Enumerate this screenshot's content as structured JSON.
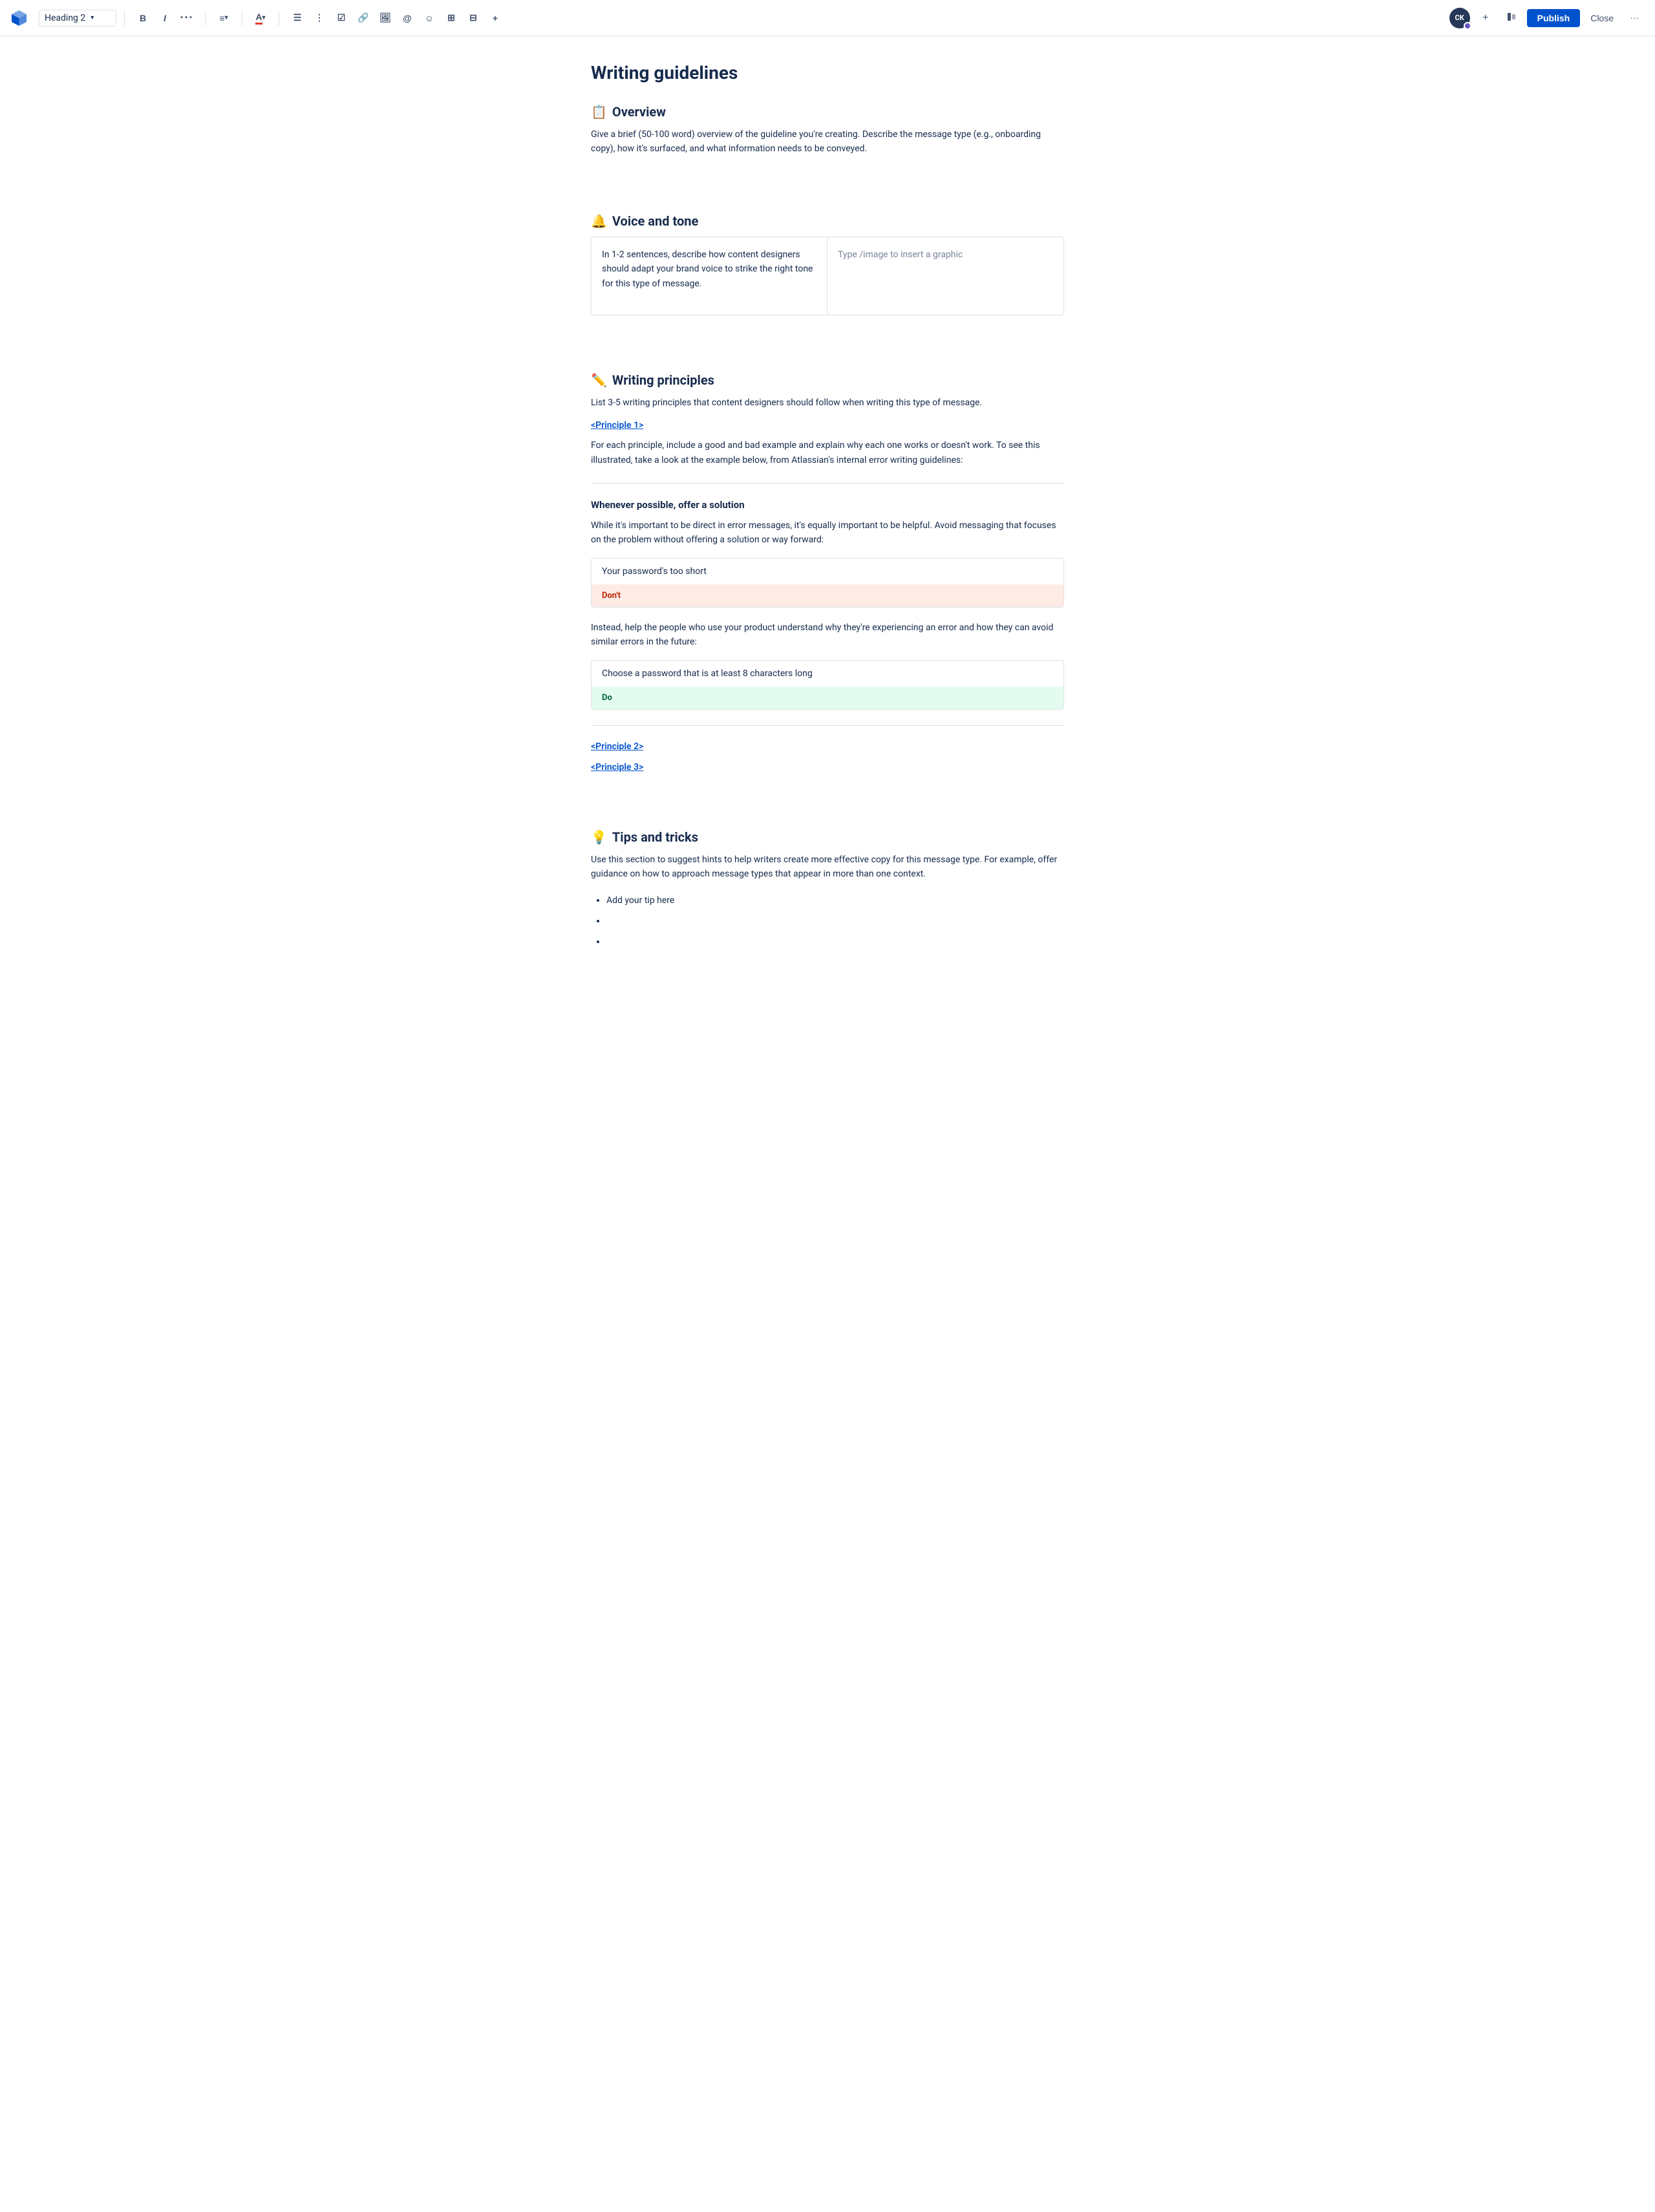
{
  "toolbar": {
    "heading_selector": "Heading 2",
    "chevron": "▾",
    "bold_label": "B",
    "italic_label": "I",
    "more_label": "•••",
    "align_label": "≡",
    "color_label": "A",
    "unordered_list_label": "☰",
    "ordered_list_label": "☰",
    "task_label": "✓",
    "link_label": "🔗",
    "image_label": "🖼",
    "mention_label": "@",
    "emoji_label": "☺",
    "table_label": "⊞",
    "layout_label": "⊟",
    "more2_label": "+",
    "avatar_initials": "CK",
    "add_label": "+",
    "share_label": "👤",
    "publish_label": "Publish",
    "close_label": "Close",
    "overflow_label": "•••"
  },
  "page": {
    "title": "Writing guidelines"
  },
  "sections": {
    "overview": {
      "icon": "📋",
      "heading": "Overview",
      "text": "Give a brief (50-100 word) overview of the guideline you're creating. Describe the message type (e.g., onboarding copy), how it's surfaced, and what information needs to be conveyed."
    },
    "voice_and_tone": {
      "icon": "🔔",
      "heading": "Voice and tone",
      "col1": "In 1-2 sentences, describe how content designers should adapt your brand voice to strike the right tone for this type of message.",
      "col2": "Type /image to insert a graphic"
    },
    "writing_principles": {
      "icon": "✏️",
      "heading": "Writing principles",
      "intro": "List 3-5 writing principles that content designers should follow when writing this type of message.",
      "principle1_link": "<Principle 1>",
      "principle1_text": "For each principle, include a good and bad example and explain why each one works or doesn't work. To see this illustrated, take a look at the example below, from Atlassian's internal error writing guidelines:",
      "example_sub_heading": "Whenever possible, offer a solution",
      "example_intro": "While it's important to be direct in error messages, it's equally important to be helpful. Avoid messaging that focuses on the problem without offering a solution or way forward:",
      "dont_example": "Your password's too short",
      "dont_label": "Don't",
      "example_middle": "Instead, help the people who use your product understand why they're experiencing an error and how they can avoid similar errors in the future:",
      "do_example": "Choose a password that is at least 8 characters long",
      "do_label": "Do",
      "principle2_link": "<Principle 2>",
      "principle3_link": "<Principle 3>"
    },
    "tips_and_tricks": {
      "icon": "💡",
      "heading": "Tips and tricks",
      "text": "Use this section to suggest hints to help writers create more effective copy for this message type. For example, offer guidance on how to approach message types that appear in more than one context.",
      "list_items": [
        "Add your tip here",
        "",
        ""
      ]
    }
  }
}
